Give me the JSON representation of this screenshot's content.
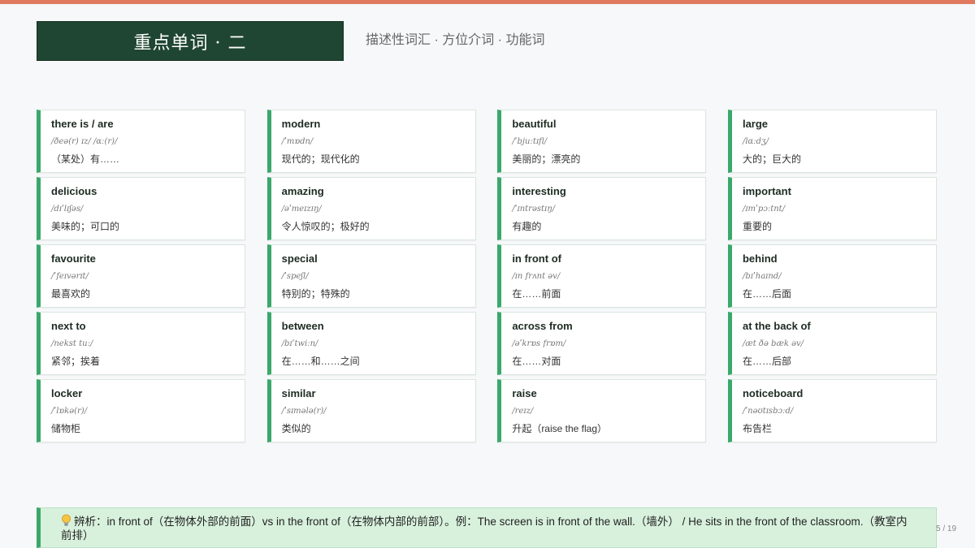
{
  "header": {
    "title": "重点单词 · 二",
    "subtitle": "描述性词汇 · 方位介词 · 功能词"
  },
  "cards": [
    {
      "word": "there is / are",
      "phonetic": "/ðeə(r) ɪz/ /ɑː(r)/",
      "meaning": "（某处）有……"
    },
    {
      "word": "modern",
      "phonetic": "/ˈmɒdn/",
      "meaning": "现代的；现代化的"
    },
    {
      "word": "beautiful",
      "phonetic": "/ˈbjuːtɪfl/",
      "meaning": "美丽的；漂亮的"
    },
    {
      "word": "large",
      "phonetic": "/lɑːdʒ/",
      "meaning": "大的；巨大的"
    },
    {
      "word": "delicious",
      "phonetic": "/dɪˈlɪʃəs/",
      "meaning": "美味的；可口的"
    },
    {
      "word": "amazing",
      "phonetic": "/əˈmeɪzɪŋ/",
      "meaning": "令人惊叹的；极好的"
    },
    {
      "word": "interesting",
      "phonetic": "/ˈɪntrəstɪŋ/",
      "meaning": "有趣的"
    },
    {
      "word": "important",
      "phonetic": "/ɪmˈpɔːtnt/",
      "meaning": "重要的"
    },
    {
      "word": "favourite",
      "phonetic": "/ˈfeɪvərɪt/",
      "meaning": "最喜欢的"
    },
    {
      "word": "special",
      "phonetic": "/ˈspeʃl/",
      "meaning": "特别的；特殊的"
    },
    {
      "word": "in front of",
      "phonetic": "/ɪn frʌnt əv/",
      "meaning": "在……前面"
    },
    {
      "word": "behind",
      "phonetic": "/bɪˈhaɪnd/",
      "meaning": "在……后面"
    },
    {
      "word": "next to",
      "phonetic": "/nekst tuː/",
      "meaning": "紧邻；挨着"
    },
    {
      "word": "between",
      "phonetic": "/bɪˈtwiːn/",
      "meaning": "在……和……之间"
    },
    {
      "word": "across from",
      "phonetic": "/əˈkrɒs frɒm/",
      "meaning": "在……对面"
    },
    {
      "word": "at the back of",
      "phonetic": "/æt ðə bæk əv/",
      "meaning": "在……后部"
    },
    {
      "word": "locker",
      "phonetic": "/ˈlɒkə(r)/",
      "meaning": "储物柜"
    },
    {
      "word": "similar",
      "phonetic": "/ˈsɪmələ(r)/",
      "meaning": "类似的"
    },
    {
      "word": "raise",
      "phonetic": "/reɪz/",
      "meaning": "升起（raise the flag）"
    },
    {
      "word": "noticeboard",
      "phonetic": "/ˈnəʊtɪsbɔːd/",
      "meaning": "布告栏"
    }
  ],
  "note": {
    "icon": "lightbulb-icon",
    "text": "辨析：in front of（在物体外部的前面）vs in the front of（在物体内部的前部）。例：The screen is in front of the wall.（墙外） / He sits in the front of the classroom.（教室内前排）"
  },
  "page": {
    "number": "5 / 19"
  },
  "colors": {
    "accent_bar": "#e07a5f",
    "title_bg": "#1f4632",
    "card_accent": "#3aa86b",
    "note_bg": "#d8f1dd"
  }
}
